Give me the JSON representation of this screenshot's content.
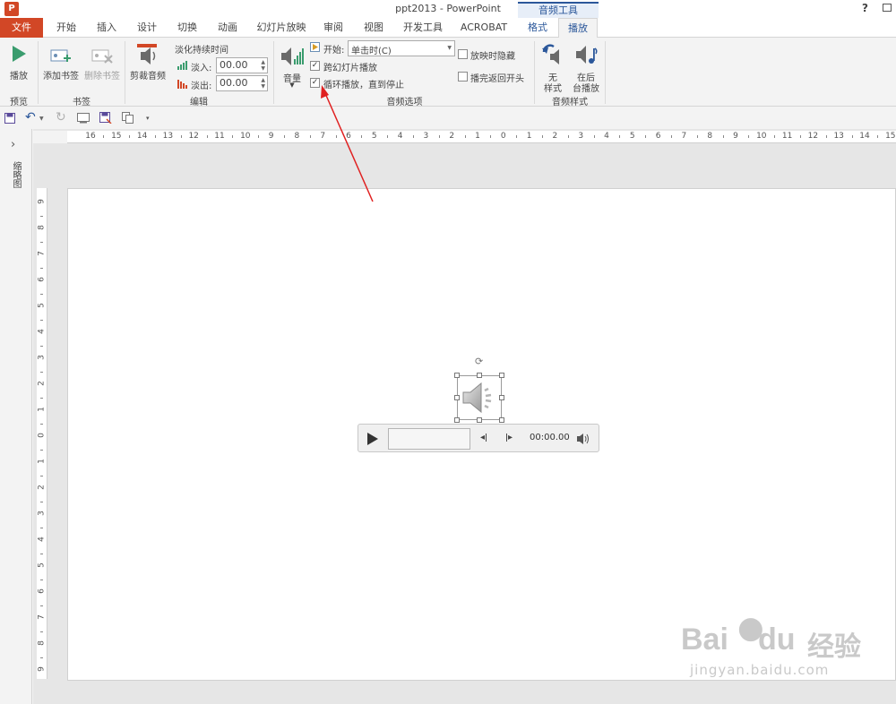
{
  "titlebar": {
    "title": "ppt2013 - PowerPoint",
    "help": "?",
    "context_tab_group": "音频工具"
  },
  "tabs": [
    "文件",
    "开始",
    "插入",
    "设计",
    "切换",
    "动画",
    "幻灯片放映",
    "审阅",
    "视图",
    "开发工具",
    "ACROBAT",
    "格式",
    "播放"
  ],
  "ribbon": {
    "preview": {
      "play": "播放",
      "group": "预览"
    },
    "bookmarks": {
      "add": "添加书签",
      "remove": "删除书签",
      "group": "书签"
    },
    "editing": {
      "trim": "剪裁音频",
      "fade_title": "淡化持续时间",
      "fade_in_label": "淡入:",
      "fade_in_value": "00.00",
      "fade_out_label": "淡出:",
      "fade_out_value": "00.00",
      "group": "编辑"
    },
    "audio_options": {
      "volume": "音量",
      "start_label": "开始:",
      "start_value": "单击时(C)",
      "play_across_slides": "跨幻灯片播放",
      "loop_until_stopped": "循环播放，直到停止",
      "hide_during_show": "放映时隐藏",
      "rewind_after_playing": "播完返回开头",
      "group": "音频选项",
      "checks": {
        "play_across_slides": true,
        "loop_until_stopped": true,
        "hide_during_show": false,
        "rewind_after_playing": false
      }
    },
    "audio_styles": {
      "no_style_1": "无",
      "no_style_2": "样式",
      "background_1": "在后",
      "background_2": "台播放",
      "group": "音频样式"
    }
  },
  "left_pane": {
    "expand": "›",
    "label": "缩略图"
  },
  "ruler": {
    "h_ticks": [
      "16",
      "15",
      "14",
      "13",
      "12",
      "11",
      "10",
      "9",
      "8",
      "7",
      "6",
      "5",
      "4",
      "3",
      "2",
      "1",
      "0",
      "1",
      "2",
      "3",
      "4",
      "5",
      "6",
      "7",
      "8",
      "9",
      "10",
      "11",
      "12",
      "13",
      "14",
      "15"
    ],
    "v_ticks": [
      "9",
      "8",
      "7",
      "6",
      "5",
      "4",
      "3",
      "2",
      "1",
      "0",
      "1",
      "2",
      "3",
      "4",
      "5",
      "6",
      "7",
      "8",
      "9"
    ]
  },
  "player": {
    "time": "00:00.00"
  },
  "watermark": {
    "brand": "Bai",
    "brand2": "du",
    "cn": "经验",
    "url": "jingyan.baidu.com"
  },
  "colors": {
    "file_tab": "#d24726",
    "accent": "#2b579a",
    "arrow": "#e02020",
    "play_green": "#3a9c6e"
  }
}
